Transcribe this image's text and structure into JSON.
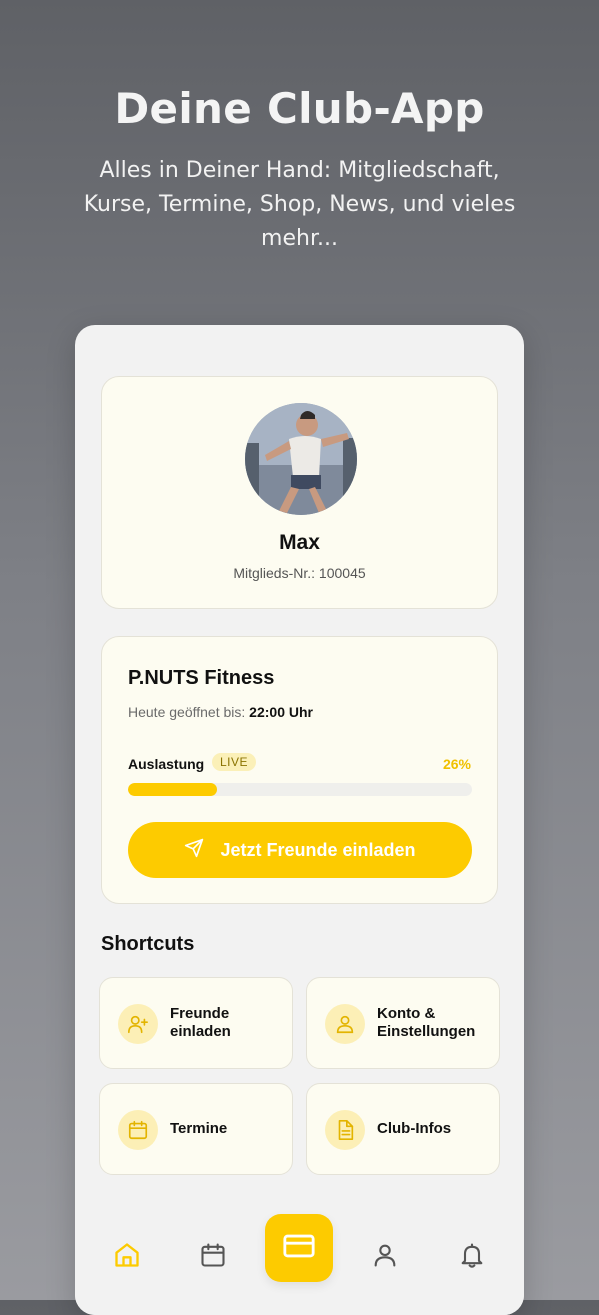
{
  "hero": {
    "title": "Deine Club-App",
    "subtitle": "Alles in Deiner Hand: Mitgliedschaft, Kurse, Termine, Shop, News, und vieles mehr..."
  },
  "profile": {
    "name": "Max",
    "member_label": "Mitglieds-Nr.:",
    "member_number": "100045"
  },
  "club": {
    "name": "P.NUTS Fitness",
    "hours_label": "Heute geöffnet bis:",
    "hours_value": "22:00 Uhr",
    "load_label": "Auslastung",
    "live_badge": "LIVE",
    "load_percent_text": "26%",
    "load_fraction": 0.26,
    "invite_button": "Jetzt Freunde einladen"
  },
  "shortcuts": {
    "title": "Shortcuts",
    "items": [
      {
        "label": "Freunde einladen",
        "icon": "user-plus-icon"
      },
      {
        "label": "Konto & Einstellungen",
        "icon": "user-icon"
      },
      {
        "label": "Termine",
        "icon": "calendar-icon"
      },
      {
        "label": "Club-Infos",
        "icon": "document-icon"
      }
    ]
  },
  "tabbar": {
    "items": [
      "home-icon",
      "calendar-icon",
      "card-icon",
      "profile-icon",
      "bell-icon"
    ],
    "active": "home-icon"
  },
  "colors": {
    "accent": "#fdcb00",
    "card_bg": "#fdfcf1",
    "icon_bg": "#fcefb6",
    "icon_stroke": "#e3b400"
  }
}
